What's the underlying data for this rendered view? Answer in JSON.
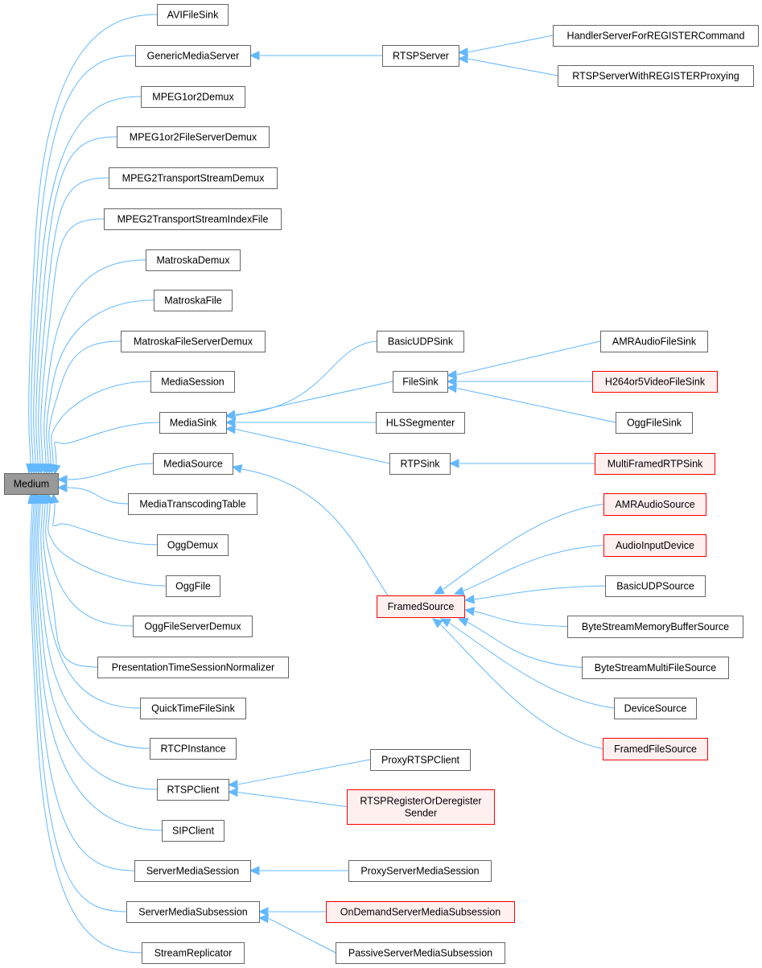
{
  "diagram": {
    "type": "class-inheritance-graph",
    "root": "Medium",
    "colors": {
      "edge": "#63b8ff",
      "normal_fill": "#ffffff",
      "normal_border": "#666666",
      "root_fill": "#999999",
      "root_border": "#666666",
      "truncated_fill": "#fff0f0",
      "truncated_border": "#ff0000"
    },
    "nodes": [
      {
        "id": "Medium",
        "label": [
          "Medium"
        ],
        "style": "root"
      },
      {
        "id": "AVIFileSink",
        "label": [
          "AVIFileSink"
        ],
        "style": "normal"
      },
      {
        "id": "GenericMediaServer",
        "label": [
          "GenericMediaServer"
        ],
        "style": "normal"
      },
      {
        "id": "MPEG1or2Demux",
        "label": [
          "MPEG1or2Demux"
        ],
        "style": "normal"
      },
      {
        "id": "MPEG1or2FileServerDemux",
        "label": [
          "MPEG1or2FileServerDemux"
        ],
        "style": "normal"
      },
      {
        "id": "MPEG2TransportStreamDemux",
        "label": [
          "MPEG2TransportStreamDemux"
        ],
        "style": "normal"
      },
      {
        "id": "MPEG2TransportStreamIndexFile",
        "label": [
          "MPEG2TransportStreamIndexFile"
        ],
        "style": "normal"
      },
      {
        "id": "MatroskaDemux",
        "label": [
          "MatroskaDemux"
        ],
        "style": "normal"
      },
      {
        "id": "MatroskaFile",
        "label": [
          "MatroskaFile"
        ],
        "style": "normal"
      },
      {
        "id": "MatroskaFileServerDemux",
        "label": [
          "MatroskaFileServerDemux"
        ],
        "style": "normal"
      },
      {
        "id": "MediaSession",
        "label": [
          "MediaSession"
        ],
        "style": "normal"
      },
      {
        "id": "MediaSink",
        "label": [
          "MediaSink"
        ],
        "style": "normal"
      },
      {
        "id": "MediaSource",
        "label": [
          "MediaSource"
        ],
        "style": "normal"
      },
      {
        "id": "MediaTranscodingTable",
        "label": [
          "MediaTranscodingTable"
        ],
        "style": "normal"
      },
      {
        "id": "OggDemux",
        "label": [
          "OggDemux"
        ],
        "style": "normal"
      },
      {
        "id": "OggFile",
        "label": [
          "OggFile"
        ],
        "style": "normal"
      },
      {
        "id": "OggFileServerDemux",
        "label": [
          "OggFileServerDemux"
        ],
        "style": "normal"
      },
      {
        "id": "PresentationTimeSessionNormalizer",
        "label": [
          "PresentationTimeSessionNormalizer"
        ],
        "style": "normal"
      },
      {
        "id": "QuickTimeFileSink",
        "label": [
          "QuickTimeFileSink"
        ],
        "style": "normal"
      },
      {
        "id": "RTCPInstance",
        "label": [
          "RTCPInstance"
        ],
        "style": "normal"
      },
      {
        "id": "RTSPClient",
        "label": [
          "RTSPClient"
        ],
        "style": "normal"
      },
      {
        "id": "SIPClient",
        "label": [
          "SIPClient"
        ],
        "style": "normal"
      },
      {
        "id": "ServerMediaSession",
        "label": [
          "ServerMediaSession"
        ],
        "style": "normal"
      },
      {
        "id": "ServerMediaSubsession",
        "label": [
          "ServerMediaSubsession"
        ],
        "style": "normal"
      },
      {
        "id": "StreamReplicator",
        "label": [
          "StreamReplicator"
        ],
        "style": "normal"
      },
      {
        "id": "RTSPServer",
        "label": [
          "RTSPServer"
        ],
        "style": "normal"
      },
      {
        "id": "HandlerServerForREGISTERCommand",
        "label": [
          "HandlerServerForREGISTERCommand"
        ],
        "style": "normal"
      },
      {
        "id": "RTSPServerWithREGISTERProxying",
        "label": [
          "RTSPServerWithREGISTERProxying"
        ],
        "style": "normal"
      },
      {
        "id": "BasicUDPSink",
        "label": [
          "BasicUDPSink"
        ],
        "style": "normal"
      },
      {
        "id": "FileSink",
        "label": [
          "FileSink"
        ],
        "style": "normal"
      },
      {
        "id": "HLSSegmenter",
        "label": [
          "HLSSegmenter"
        ],
        "style": "normal"
      },
      {
        "id": "RTPSink",
        "label": [
          "RTPSink"
        ],
        "style": "normal"
      },
      {
        "id": "AMRAudioFileSink",
        "label": [
          "AMRAudioFileSink"
        ],
        "style": "normal"
      },
      {
        "id": "H264or5VideoFileSink",
        "label": [
          "H264or5VideoFileSink"
        ],
        "style": "truncated"
      },
      {
        "id": "OggFileSink",
        "label": [
          "OggFileSink"
        ],
        "style": "normal"
      },
      {
        "id": "MultiFramedRTPSink",
        "label": [
          "MultiFramedRTPSink"
        ],
        "style": "truncated"
      },
      {
        "id": "FramedSource",
        "label": [
          "FramedSource"
        ],
        "style": "truncated"
      },
      {
        "id": "AMRAudioSource",
        "label": [
          "AMRAudioSource"
        ],
        "style": "truncated"
      },
      {
        "id": "AudioInputDevice",
        "label": [
          "AudioInputDevice"
        ],
        "style": "truncated"
      },
      {
        "id": "BasicUDPSource",
        "label": [
          "BasicUDPSource"
        ],
        "style": "normal"
      },
      {
        "id": "ByteStreamMemoryBufferSource",
        "label": [
          "ByteStreamMemoryBufferSource"
        ],
        "style": "normal"
      },
      {
        "id": "ByteStreamMultiFileSource",
        "label": [
          "ByteStreamMultiFileSource"
        ],
        "style": "normal"
      },
      {
        "id": "DeviceSource",
        "label": [
          "DeviceSource"
        ],
        "style": "normal"
      },
      {
        "id": "FramedFileSource",
        "label": [
          "FramedFileSource"
        ],
        "style": "truncated"
      },
      {
        "id": "ProxyRTSPClient",
        "label": [
          "ProxyRTSPClient"
        ],
        "style": "normal"
      },
      {
        "id": "RTSPRegisterOrDeregisterSender",
        "label": [
          "RTSPRegisterOrDeregister",
          "Sender"
        ],
        "style": "truncated"
      },
      {
        "id": "ProxyServerMediaSession",
        "label": [
          "ProxyServerMediaSession"
        ],
        "style": "normal"
      },
      {
        "id": "OnDemandServerMediaSubsession",
        "label": [
          "OnDemandServerMediaSubsession"
        ],
        "style": "truncated"
      },
      {
        "id": "PassiveServerMediaSubsession",
        "label": [
          "PassiveServerMediaSubsession"
        ],
        "style": "normal"
      }
    ],
    "edges": [
      {
        "from": "AVIFileSink",
        "to": "Medium"
      },
      {
        "from": "GenericMediaServer",
        "to": "Medium"
      },
      {
        "from": "MPEG1or2Demux",
        "to": "Medium"
      },
      {
        "from": "MPEG1or2FileServerDemux",
        "to": "Medium"
      },
      {
        "from": "MPEG2TransportStreamDemux",
        "to": "Medium"
      },
      {
        "from": "MPEG2TransportStreamIndexFile",
        "to": "Medium"
      },
      {
        "from": "MatroskaDemux",
        "to": "Medium"
      },
      {
        "from": "MatroskaFile",
        "to": "Medium"
      },
      {
        "from": "MatroskaFileServerDemux",
        "to": "Medium"
      },
      {
        "from": "MediaSession",
        "to": "Medium"
      },
      {
        "from": "MediaSink",
        "to": "Medium"
      },
      {
        "from": "MediaSource",
        "to": "Medium"
      },
      {
        "from": "MediaTranscodingTable",
        "to": "Medium"
      },
      {
        "from": "OggDemux",
        "to": "Medium"
      },
      {
        "from": "OggFile",
        "to": "Medium"
      },
      {
        "from": "OggFileServerDemux",
        "to": "Medium"
      },
      {
        "from": "PresentationTimeSessionNormalizer",
        "to": "Medium"
      },
      {
        "from": "QuickTimeFileSink",
        "to": "Medium"
      },
      {
        "from": "RTCPInstance",
        "to": "Medium"
      },
      {
        "from": "RTSPClient",
        "to": "Medium"
      },
      {
        "from": "SIPClient",
        "to": "Medium"
      },
      {
        "from": "ServerMediaSession",
        "to": "Medium"
      },
      {
        "from": "ServerMediaSubsession",
        "to": "Medium"
      },
      {
        "from": "StreamReplicator",
        "to": "Medium"
      },
      {
        "from": "RTSPServer",
        "to": "GenericMediaServer"
      },
      {
        "from": "HandlerServerForREGISTERCommand",
        "to": "RTSPServer"
      },
      {
        "from": "RTSPServerWithREGISTERProxying",
        "to": "RTSPServer"
      },
      {
        "from": "BasicUDPSink",
        "to": "MediaSink"
      },
      {
        "from": "FileSink",
        "to": "MediaSink"
      },
      {
        "from": "HLSSegmenter",
        "to": "MediaSink"
      },
      {
        "from": "RTPSink",
        "to": "MediaSink"
      },
      {
        "from": "AMRAudioFileSink",
        "to": "FileSink"
      },
      {
        "from": "H264or5VideoFileSink",
        "to": "FileSink"
      },
      {
        "from": "OggFileSink",
        "to": "FileSink"
      },
      {
        "from": "MultiFramedRTPSink",
        "to": "RTPSink"
      },
      {
        "from": "FramedSource",
        "to": "MediaSource"
      },
      {
        "from": "AMRAudioSource",
        "to": "FramedSource"
      },
      {
        "from": "AudioInputDevice",
        "to": "FramedSource"
      },
      {
        "from": "BasicUDPSource",
        "to": "FramedSource"
      },
      {
        "from": "ByteStreamMemoryBufferSource",
        "to": "FramedSource"
      },
      {
        "from": "ByteStreamMultiFileSource",
        "to": "FramedSource"
      },
      {
        "from": "DeviceSource",
        "to": "FramedSource"
      },
      {
        "from": "FramedFileSource",
        "to": "FramedSource"
      },
      {
        "from": "ProxyRTSPClient",
        "to": "RTSPClient"
      },
      {
        "from": "RTSPRegisterOrDeregisterSender",
        "to": "RTSPClient"
      },
      {
        "from": "ProxyServerMediaSession",
        "to": "ServerMediaSession"
      },
      {
        "from": "OnDemandServerMediaSubsession",
        "to": "ServerMediaSubsession"
      },
      {
        "from": "PassiveServerMediaSubsession",
        "to": "ServerMediaSubsession"
      }
    ]
  }
}
